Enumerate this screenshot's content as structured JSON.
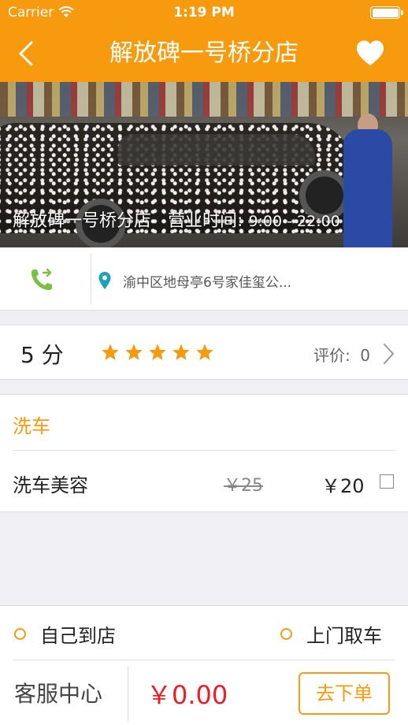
{
  "status_bar": {
    "carrier": "Carrier",
    "time": "1:19 PM",
    "wifi_icon": "wifi-icon",
    "battery_icon": "battery-icon"
  },
  "nav": {
    "back_icon": "chevron-left-icon",
    "title": "解放碑一号桥分店",
    "favorite_icon": "heart-icon"
  },
  "hero": {
    "store_name": "解放碑一号桥分店",
    "hours_label": "营业时间:",
    "hours_value": "9:00 - 22:00"
  },
  "contact": {
    "phone_icon": "phone-forward-icon",
    "location_icon": "map-pin-icon",
    "address": "渝中区地母亭6号家佳玺公..."
  },
  "rating": {
    "score": "5 分",
    "stars": 5,
    "review_label": "评价:",
    "review_count": "0"
  },
  "service": {
    "category": "洗车",
    "items": [
      {
        "name": "洗车美容",
        "old_price": "￥25",
        "price": "￥20",
        "selected": false
      }
    ]
  },
  "bottom": {
    "option_self": "自己到店",
    "option_pickup": "上门取车",
    "customer_service": "客服中心",
    "total": "￥0.00",
    "order_button": "去下单"
  },
  "colors": {
    "brand": "#f79a0e",
    "price_red": "#ee1c24"
  }
}
